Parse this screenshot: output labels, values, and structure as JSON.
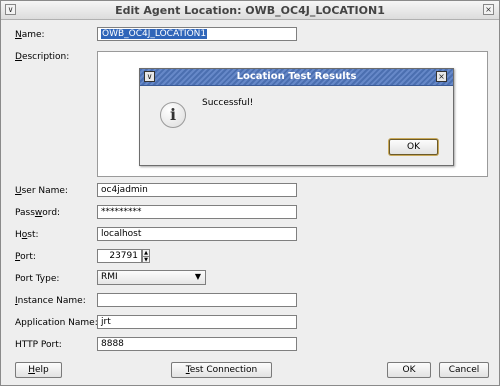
{
  "window": {
    "title": "Edit Agent Location: OWB_OC4J_LOCATION1",
    "menu_glyph": "∨",
    "close_glyph": "×"
  },
  "form": {
    "name": {
      "label": "Name:",
      "value": "OWB_OC4J_LOCATION1"
    },
    "description": {
      "label": "Description:"
    },
    "user_name": {
      "label": "User Name:",
      "value": "oc4jadmin"
    },
    "password": {
      "label": "Password:",
      "value": "*********"
    },
    "host": {
      "label": "Host:",
      "value": "localhost"
    },
    "port": {
      "label": "Port:",
      "value": "23791"
    },
    "port_type": {
      "label": "Port Type:",
      "value": "RMI"
    },
    "instance_name": {
      "label": "Instance Name:",
      "value": ""
    },
    "application_name": {
      "label": "Application Name:",
      "value": "jrt"
    },
    "http_port": {
      "label": "HTTP Port:",
      "value": "8888"
    }
  },
  "buttons": {
    "help": "Help",
    "test_connection": "Test Connection",
    "ok": "OK",
    "cancel": "Cancel"
  },
  "dialog": {
    "title": "Location Test Results",
    "message": "Successful!",
    "ok": "OK",
    "info_glyph": "i"
  },
  "colors": {
    "dialog_title_bar": "#5577bb",
    "selection": "#2f65b9"
  }
}
